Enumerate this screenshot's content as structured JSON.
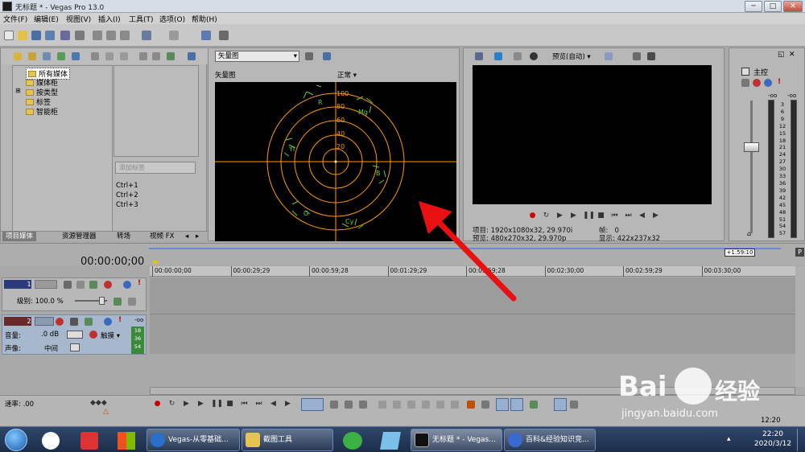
{
  "window": {
    "title": "无标题 * - Vegas Pro 13.0",
    "min": "─",
    "max": "□",
    "close": "✕"
  },
  "menu": [
    "文件(F)",
    "编辑(E)",
    "视图(V)",
    "插入(I)",
    "工具(T)",
    "选项(O)",
    "帮助(H)"
  ],
  "media": {
    "tree": [
      "所有媒体",
      "媒体柜",
      "按类型",
      "标签",
      "智能柜"
    ],
    "tag_placeholder": "添加标签",
    "shortcuts": [
      "Ctrl+1",
      "Ctrl+2",
      "Ctrl+3"
    ],
    "tabs": [
      "项目媒体",
      "资源管理器",
      "转场",
      "视频 FX"
    ]
  },
  "scope": {
    "select": "矢量图",
    "label": "矢量图",
    "mode": "正常",
    "scale": [
      "100",
      "80",
      "60",
      "40",
      "20"
    ],
    "targets": [
      "R",
      "Mg",
      "YI",
      "B",
      "G",
      "Cy"
    ]
  },
  "preview": {
    "quality": "预览(自动)",
    "project_label": "项目:",
    "project_value": "1920x1080x32, 29.970i",
    "preview_label": "预览:",
    "preview_value": "480x270x32, 29.970p",
    "frame_label": "帧:",
    "frame_value": "0",
    "display_label": "显示:",
    "display_value": "422x237x32"
  },
  "master": {
    "title": "主控",
    "top_left": "-oo",
    "top_right": "-oo",
    "scale": [
      "3",
      "6",
      "9",
      "12",
      "15",
      "18",
      "21",
      "24",
      "27",
      "30",
      "33",
      "36",
      "39",
      "42",
      "45",
      "48",
      "51",
      "54",
      "57"
    ]
  },
  "timeline": {
    "timecode": "00:00:00;00",
    "end_marker": "+1:59:10",
    "ruler": [
      "00:00:00;00",
      "00:00:29;29",
      "00:00:59;28",
      "00:01:29;29",
      "00:01:59;28",
      "00:02:30;00",
      "00:02:59;29",
      "00:03:30;00"
    ],
    "video_track": {
      "num": "1",
      "level": "级别: 100.0 %"
    },
    "audio_track": {
      "num": "2",
      "volume_label": "音量:",
      "volume_value": ".0 dB",
      "pan_label": "声像:",
      "pan_value": "中间",
      "touch": "触摸",
      "meter": [
        "18",
        "36",
        "54"
      ],
      "meter_top": "-oo"
    },
    "rate": "速率: .00",
    "end_time": "12:20"
  },
  "taskbar": {
    "tasks": [
      "Vegas-从零基础...",
      "截图工具",
      "无标题 * - Vegas...",
      "百科&经验知识竞..."
    ],
    "clock_time": "22:20",
    "clock_date": "2020/3/12"
  },
  "watermark": {
    "brand": "Bai",
    "suffix": "经验",
    "url": "jingyan.baidu.com"
  },
  "colors": {
    "scope": "#ff9900",
    "target": "#66cc33",
    "arrow": "#e81010",
    "accent": "#2a6fc9"
  }
}
